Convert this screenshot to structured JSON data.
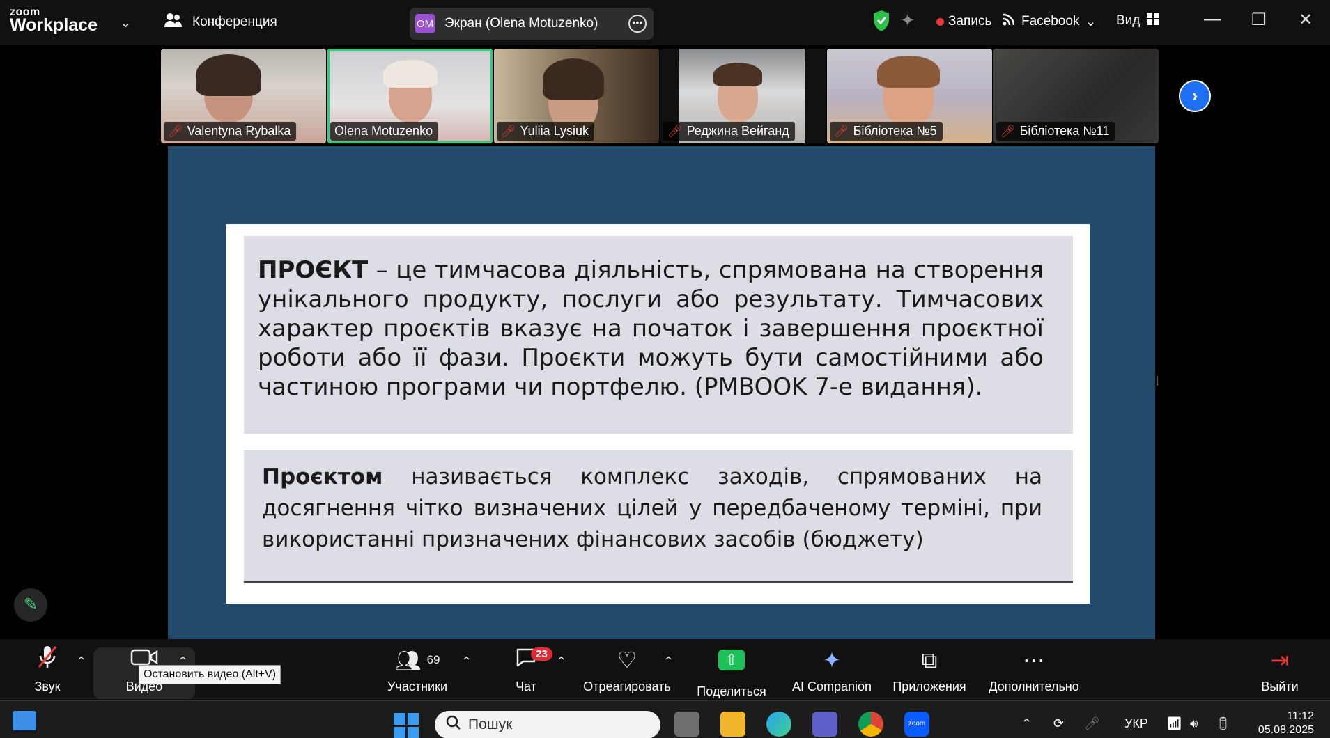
{
  "titlebar": {
    "brand_top": "zoom",
    "brand_bottom": "Workplace",
    "conference_label": "Конференция",
    "screen_share": {
      "initials": "OM",
      "label": "Экран (Olena Motuzenko)"
    },
    "recording_label": "Запись",
    "stream_label": "Facebook",
    "view_label": "Вид"
  },
  "participants_strip": [
    {
      "name": "Valentyna Rybalka",
      "muted": true,
      "active": false
    },
    {
      "name": "Olena Motuzenko",
      "muted": false,
      "active": true
    },
    {
      "name": "Yuliia Lysiuk",
      "muted": true,
      "active": false
    },
    {
      "name": "Реджина Вейганд",
      "muted": true,
      "active": false
    },
    {
      "name": "Бібліотека №5",
      "muted": true,
      "active": false
    },
    {
      "name": "Бібліотека №11",
      "muted": true,
      "active": false
    }
  ],
  "slide": {
    "p1_bold": "ПРОЄКТ",
    "p1_text": " – це тимчасова діяльність, спрямована на створення унікального продукту, послуги або результату. Тимчасових характер проєктів вказує на початок і завершення проєктної роботи або її фази. Проєкти можуть бути самостійними або частиною програми чи портфелю. (PMBOOK 7-е видання).",
    "p2_bold": "Проєктом",
    "p2_text": " називається комплекс заходів, спрямованих на досягнення чітко визначених цілей у передбаченому терміні, при використанні призначених фінансових засобів (бюджету)"
  },
  "toolbar": {
    "audio_label": "Звук",
    "video_label": "Видео",
    "participants_label": "Участники",
    "participants_count": "69",
    "chat_label": "Чат",
    "chat_badge": "23",
    "react_label": "Отреагировать",
    "share_label": "Поделиться",
    "ai_label": "AI Companion",
    "apps_label": "Приложения",
    "more_label": "Дополнительно",
    "leave_label": "Выйти",
    "video_tooltip": "Остановить видео (Alt+V)"
  },
  "taskbar": {
    "search_placeholder": "Пошук",
    "language": "УКР",
    "time": "11:12",
    "date": "05.08.2025"
  },
  "colors": {
    "share_background": "#244a6b",
    "slide_box": "#dddde6",
    "active_speaker": "#27d17c",
    "recording": "#e53935",
    "share_button": "#1ec05a"
  }
}
